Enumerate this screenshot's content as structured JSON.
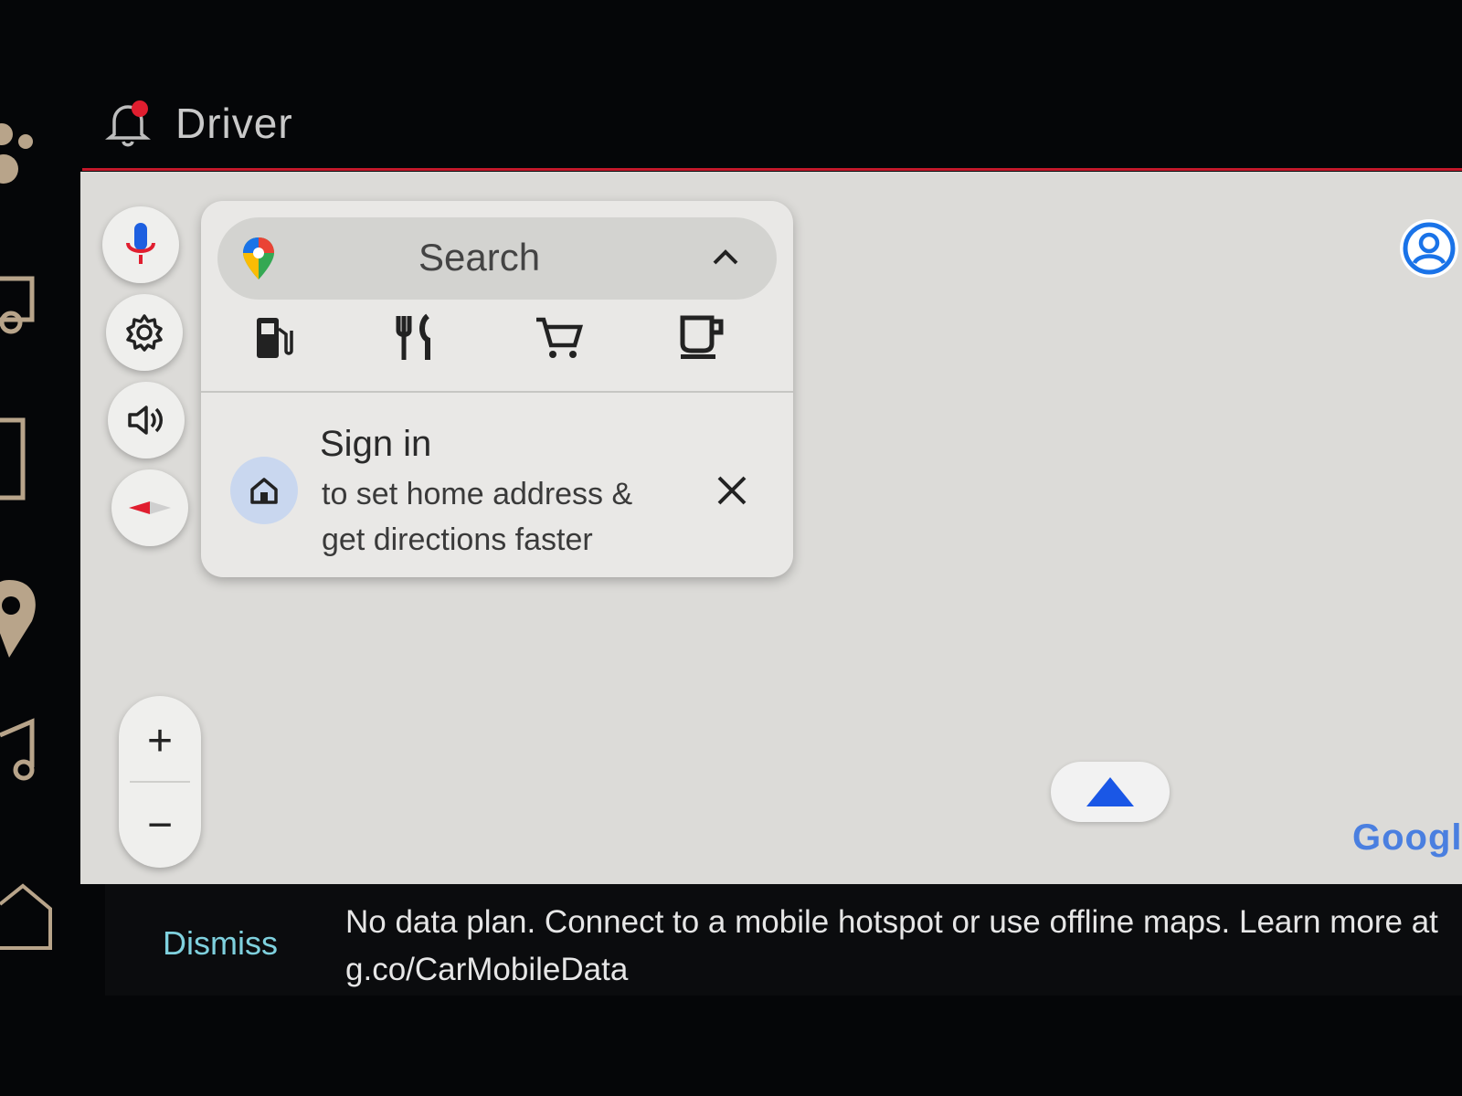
{
  "header": {
    "profile_label": "Driver"
  },
  "search": {
    "placeholder": "Search",
    "categories": [
      "gas-station",
      "restaurants",
      "grocery",
      "coffee"
    ]
  },
  "signin_card": {
    "title": "Sign in",
    "subtitle": "to set home address & get directions faster"
  },
  "zoom": {
    "in_label": "+",
    "out_label": "−"
  },
  "attribution": {
    "google": "Google"
  },
  "snackbar": {
    "action_label": "Dismiss",
    "message": "No data plan. Connect to a mobile hotspot or use offline maps. Learn more at g.co/CarMobileData"
  },
  "colors": {
    "accent_red": "#c4182a",
    "dismiss_teal": "#7fd1de",
    "recenter_blue": "#1a57e6",
    "map_bg": "#dcdbd8"
  }
}
